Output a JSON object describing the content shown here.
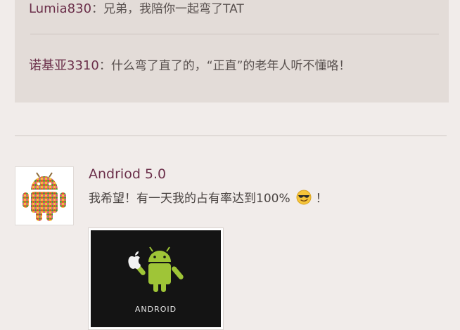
{
  "quoted_comments": [
    {
      "author": "Lumia830",
      "separator": "：",
      "text": "兄弟，我陪你一起弯了TAT"
    },
    {
      "author": "诺基亚3310",
      "separator": "：",
      "text": "什么弯了直了的，“正直”的老年人听不懂咯！"
    }
  ],
  "post": {
    "author": "Andriod 5.0",
    "text_before_emoji": "我希望！有一天我的占有率达到100%",
    "emoji": "cool-sunglasses-emoji",
    "text_after_emoji": "！",
    "image_caption": "ANDROID"
  },
  "colors": {
    "background": "#f1ecea",
    "quote_box": "#e3dcd8",
    "author": "#6b2f4a",
    "android_green": "#9fc537"
  }
}
